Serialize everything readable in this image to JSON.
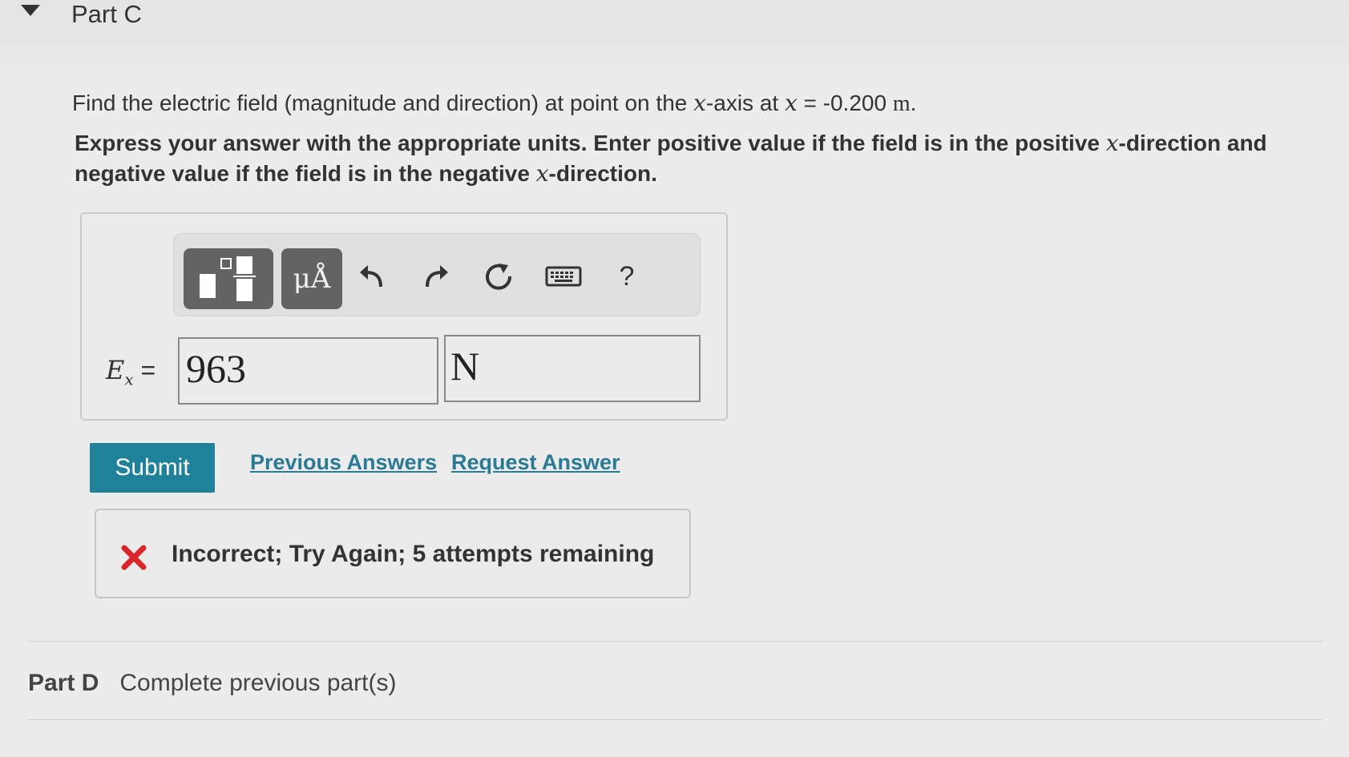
{
  "part_c": {
    "title": "Part C",
    "question_prefix": "Find the electric field (magnitude and direction) at point on the ",
    "question_var_x1": "x",
    "question_mid": "-axis at ",
    "question_var_x2": "x",
    "question_eq": " = -0.200 ",
    "question_unit": "m",
    "question_end": ".",
    "instructions_a": "Express your answer with the appropriate units. Enter positive value if the field is in the positive ",
    "instructions_var1": "x",
    "instructions_b": "-direction and negative value if the field is in the negative ",
    "instructions_var2": "x",
    "instructions_c": "-direction."
  },
  "toolbar": {
    "units_label": "μÅ",
    "help_label": "?",
    "icons": [
      "templates-icon",
      "units-icon",
      "undo-icon",
      "redo-icon",
      "reset-icon",
      "keyboard-icon",
      "help-icon"
    ]
  },
  "answer": {
    "label_var": "E",
    "label_sub": "x",
    "label_eq": " =",
    "value": "963",
    "unit": "N"
  },
  "actions": {
    "submit_label": "Submit",
    "previous_answers_label": "Previous Answers",
    "request_answer_label": "Request Answer"
  },
  "feedback": {
    "message": "Incorrect; Try Again; 5 attempts remaining",
    "status_color": "#d9262c"
  },
  "part_d": {
    "title": "Part D",
    "status": "Complete previous part(s)"
  },
  "colors": {
    "submit_bg": "#1f819a",
    "link": "#2a7a94"
  }
}
